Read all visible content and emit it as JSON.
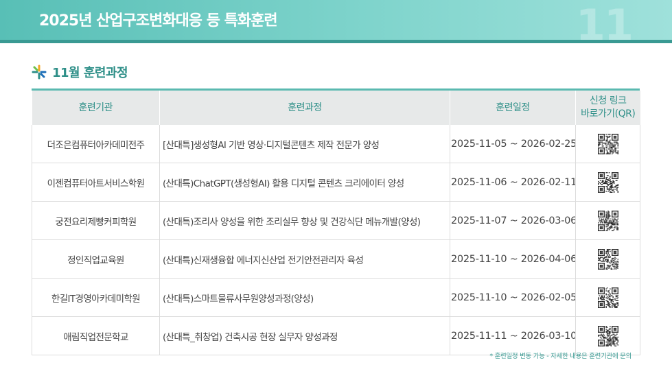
{
  "banner": {
    "title": "2025년 산업구조변화대응 등 특화훈련",
    "watermark_number": "11"
  },
  "section": {
    "title": "11월 훈련과정",
    "icon": "asterisk-star-icon"
  },
  "table": {
    "headers": {
      "institution": "훈련기관",
      "course": "훈련과정",
      "schedule": "훈련일정",
      "link_line1": "신청 링크",
      "link_line2": "바로가기(QR)"
    },
    "rows": [
      {
        "institution": "더조은컴퓨터아카데미전주",
        "course": "[산대특]생성형AI 기반 영상·디지털콘텐츠 제작 전문가 양성",
        "schedule": "2025-11-05 ~ 2026-02-25"
      },
      {
        "institution": "이젠컴퓨터아트서비스학원",
        "course": "(산대특)ChatGPT(생성형AI) 활용 디지털 콘텐츠 크리에이터 양성",
        "schedule": "2025-11-06 ~ 2026-02-11"
      },
      {
        "institution": "궁전요리제빵커피학원",
        "course": "(산대특)조리사 양성을 위한 조리실무 향상 및 건강식단 메뉴개발(양성)",
        "schedule": "2025-11-07 ~ 2026-03-06"
      },
      {
        "institution": "정인직업교육원",
        "course": "(산대특)신재생융합 에너지신산업 전기안전관리자 육성",
        "schedule": "2025-11-10 ~ 2026-04-06"
      },
      {
        "institution": "한길IT경영아카데미학원",
        "course": "(산대특)스마트물류사무원양성과정(양성)",
        "schedule": "2025-11-10 ~ 2026-02-05"
      },
      {
        "institution": "애림직업전문학교",
        "course": "(산대특_취창업) 건축시공 현장 실무자 양성과정",
        "schedule": "2025-11-11 ~ 2026-03-10"
      }
    ]
  },
  "footnote": "* 훈련일정 변동 가능 - 자세한 내용은 훈련기관에 문의",
  "colors": {
    "accent": "#2e8f88",
    "banner": "#58bfb6",
    "header_bg": "#e7e9e9"
  }
}
